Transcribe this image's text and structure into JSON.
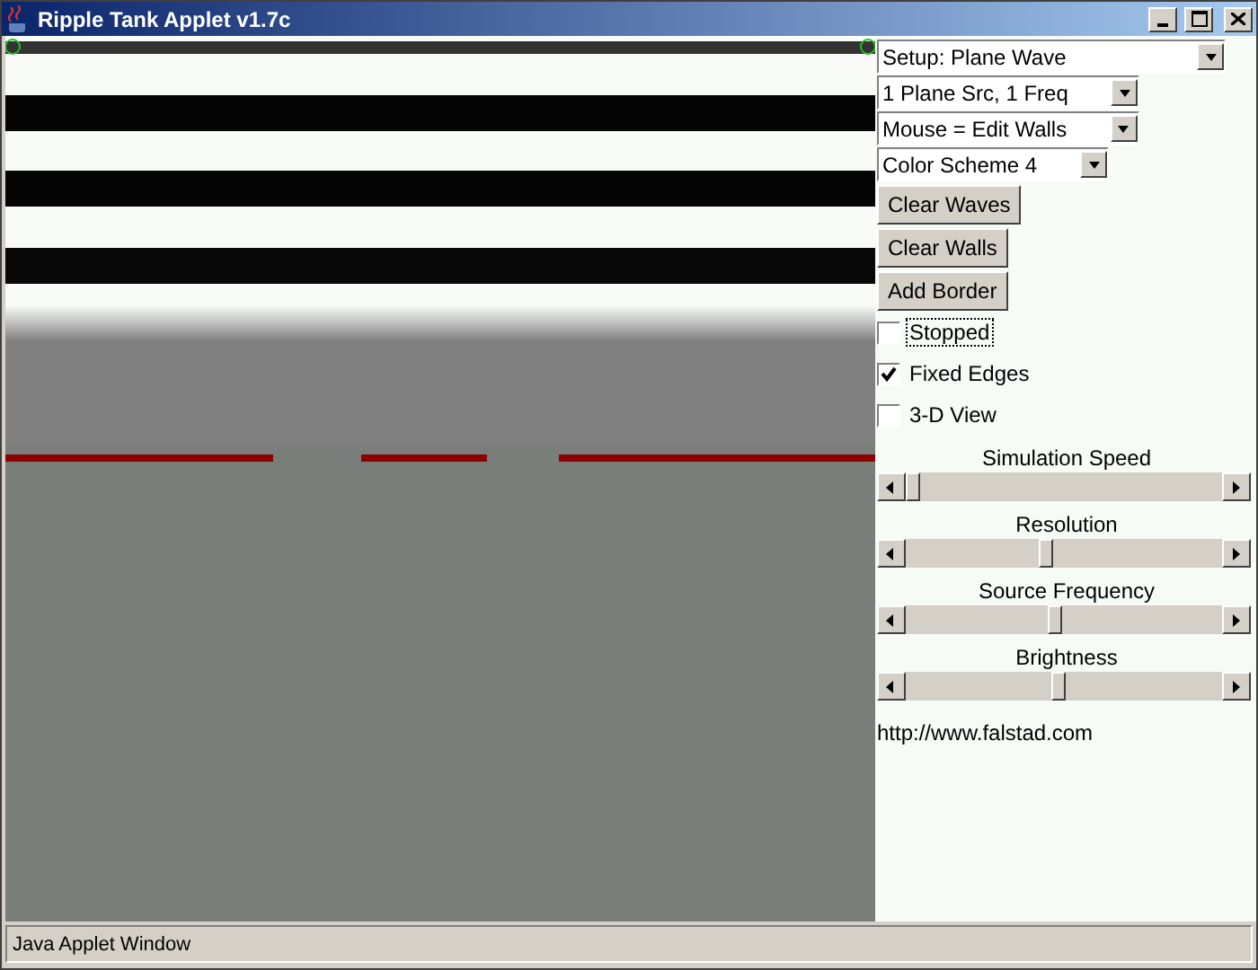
{
  "window": {
    "title": "Ripple Tank Applet v1.7c"
  },
  "dropdowns": [
    {
      "value": "Setup: Plane Wave"
    },
    {
      "value": "1 Plane Src, 1 Freq"
    },
    {
      "value": "Mouse = Edit Walls"
    },
    {
      "value": "Color Scheme 4"
    }
  ],
  "buttons": [
    "Clear Waves",
    "Clear Walls",
    "Add Border"
  ],
  "checkboxes": [
    {
      "label": "Stopped",
      "checked": false,
      "focused": true
    },
    {
      "label": "Fixed Edges",
      "checked": true,
      "focused": false
    },
    {
      "label": "3-D View",
      "checked": false,
      "focused": false
    }
  ],
  "sliders": [
    {
      "label": "Simulation Speed",
      "level": 0.0
    },
    {
      "label": "Resolution",
      "level": 0.44
    },
    {
      "label": "Source Frequency",
      "level": 0.47
    },
    {
      "label": "Brightness",
      "level": 0.48
    }
  ],
  "link": "http://www.falstad.com",
  "status_bar": "Java Applet Window"
}
